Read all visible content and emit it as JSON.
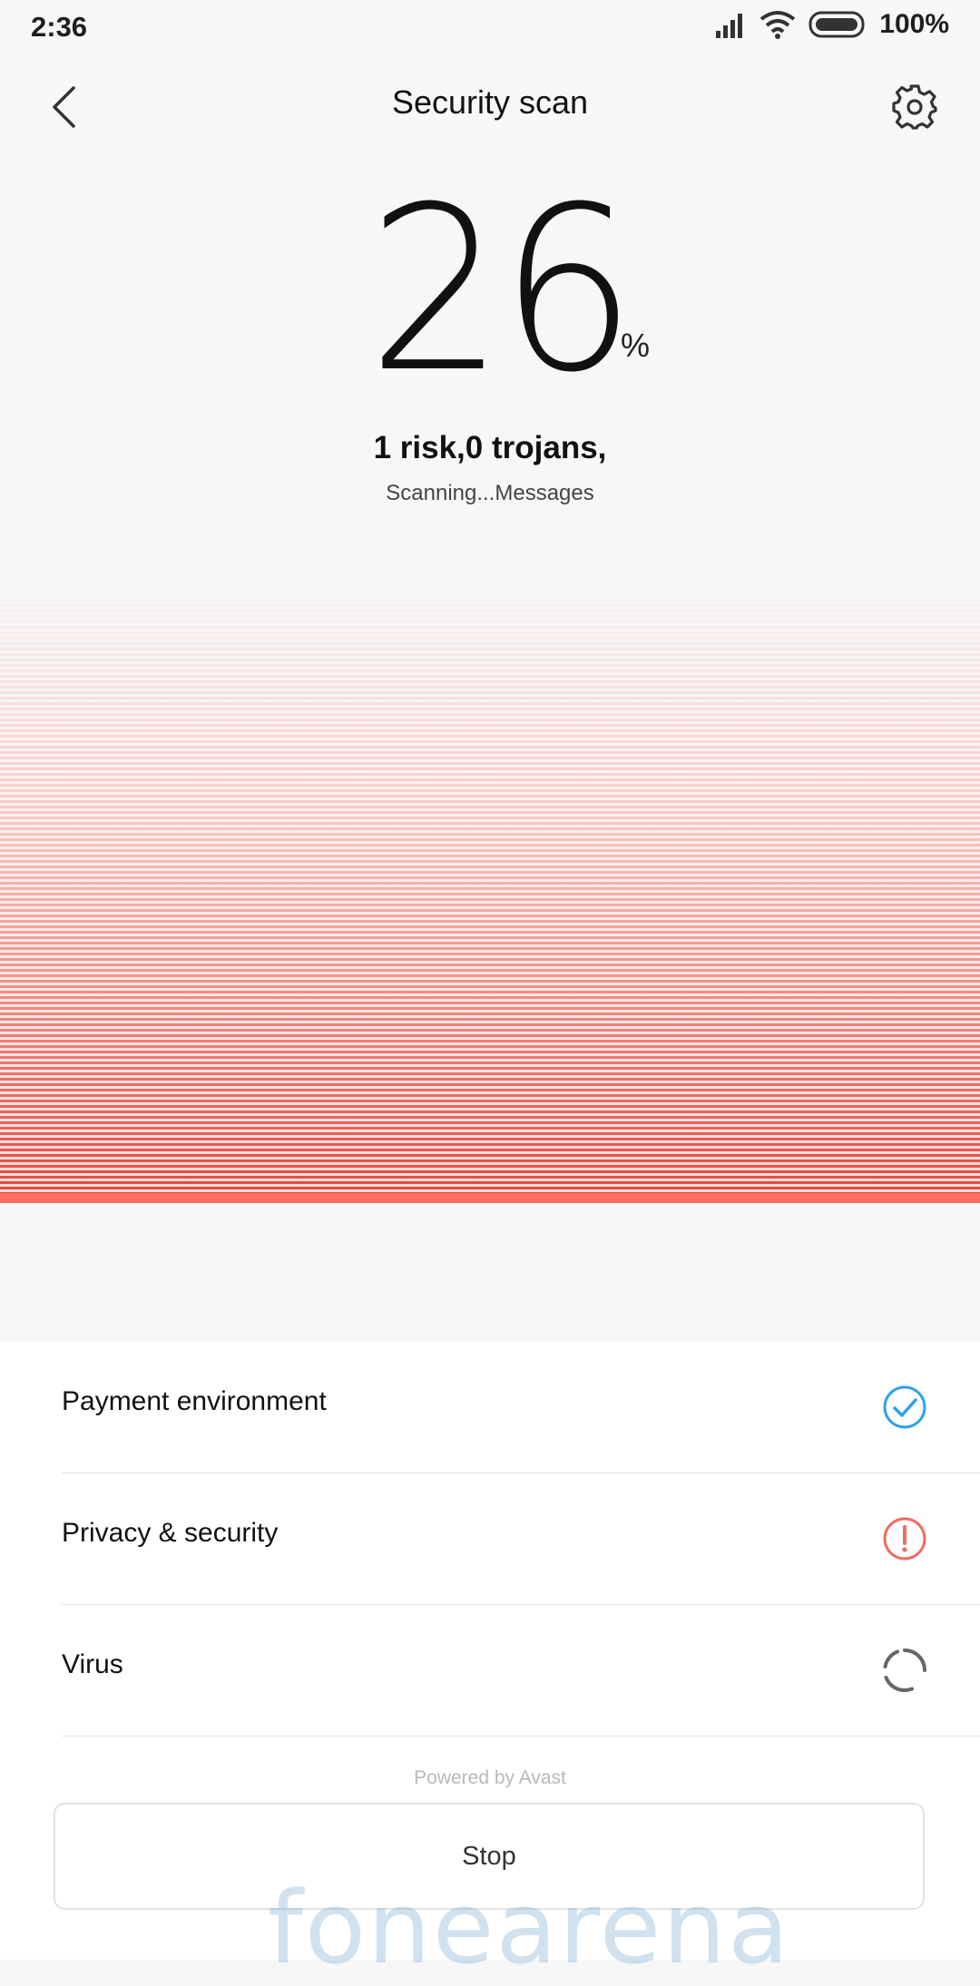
{
  "status_bar": {
    "time": "2:36",
    "battery_percent": "100%",
    "signal_icon": "cellular-signal-icon",
    "wifi_icon": "wifi-icon",
    "battery_icon": "battery-icon"
  },
  "header": {
    "title": "Security scan",
    "back_icon": "chevron-left-icon",
    "settings_icon": "gear-icon"
  },
  "progress": {
    "value": "26",
    "unit": "%",
    "risk_summary": "1 risk,0 trojans,",
    "scan_status": "Scanning...Messages"
  },
  "results": {
    "items": [
      {
        "label": "Payment environment",
        "state": "safe",
        "icon": "check-circle-icon",
        "color": "#2fa2e8"
      },
      {
        "label": "Privacy & security",
        "state": "risk",
        "icon": "alert-circle-icon",
        "color": "#f06b63"
      },
      {
        "label": "Virus",
        "state": "scanning",
        "icon": "loading-spinner-icon",
        "color": "#666666"
      }
    ]
  },
  "footer": {
    "powered_by": "Powered by Avast",
    "stop_label": "Stop"
  },
  "watermark": "fonearena",
  "colors": {
    "accent_red": "#ff6f63",
    "safe_blue": "#2fa2e8",
    "risk_red": "#f06b63"
  }
}
